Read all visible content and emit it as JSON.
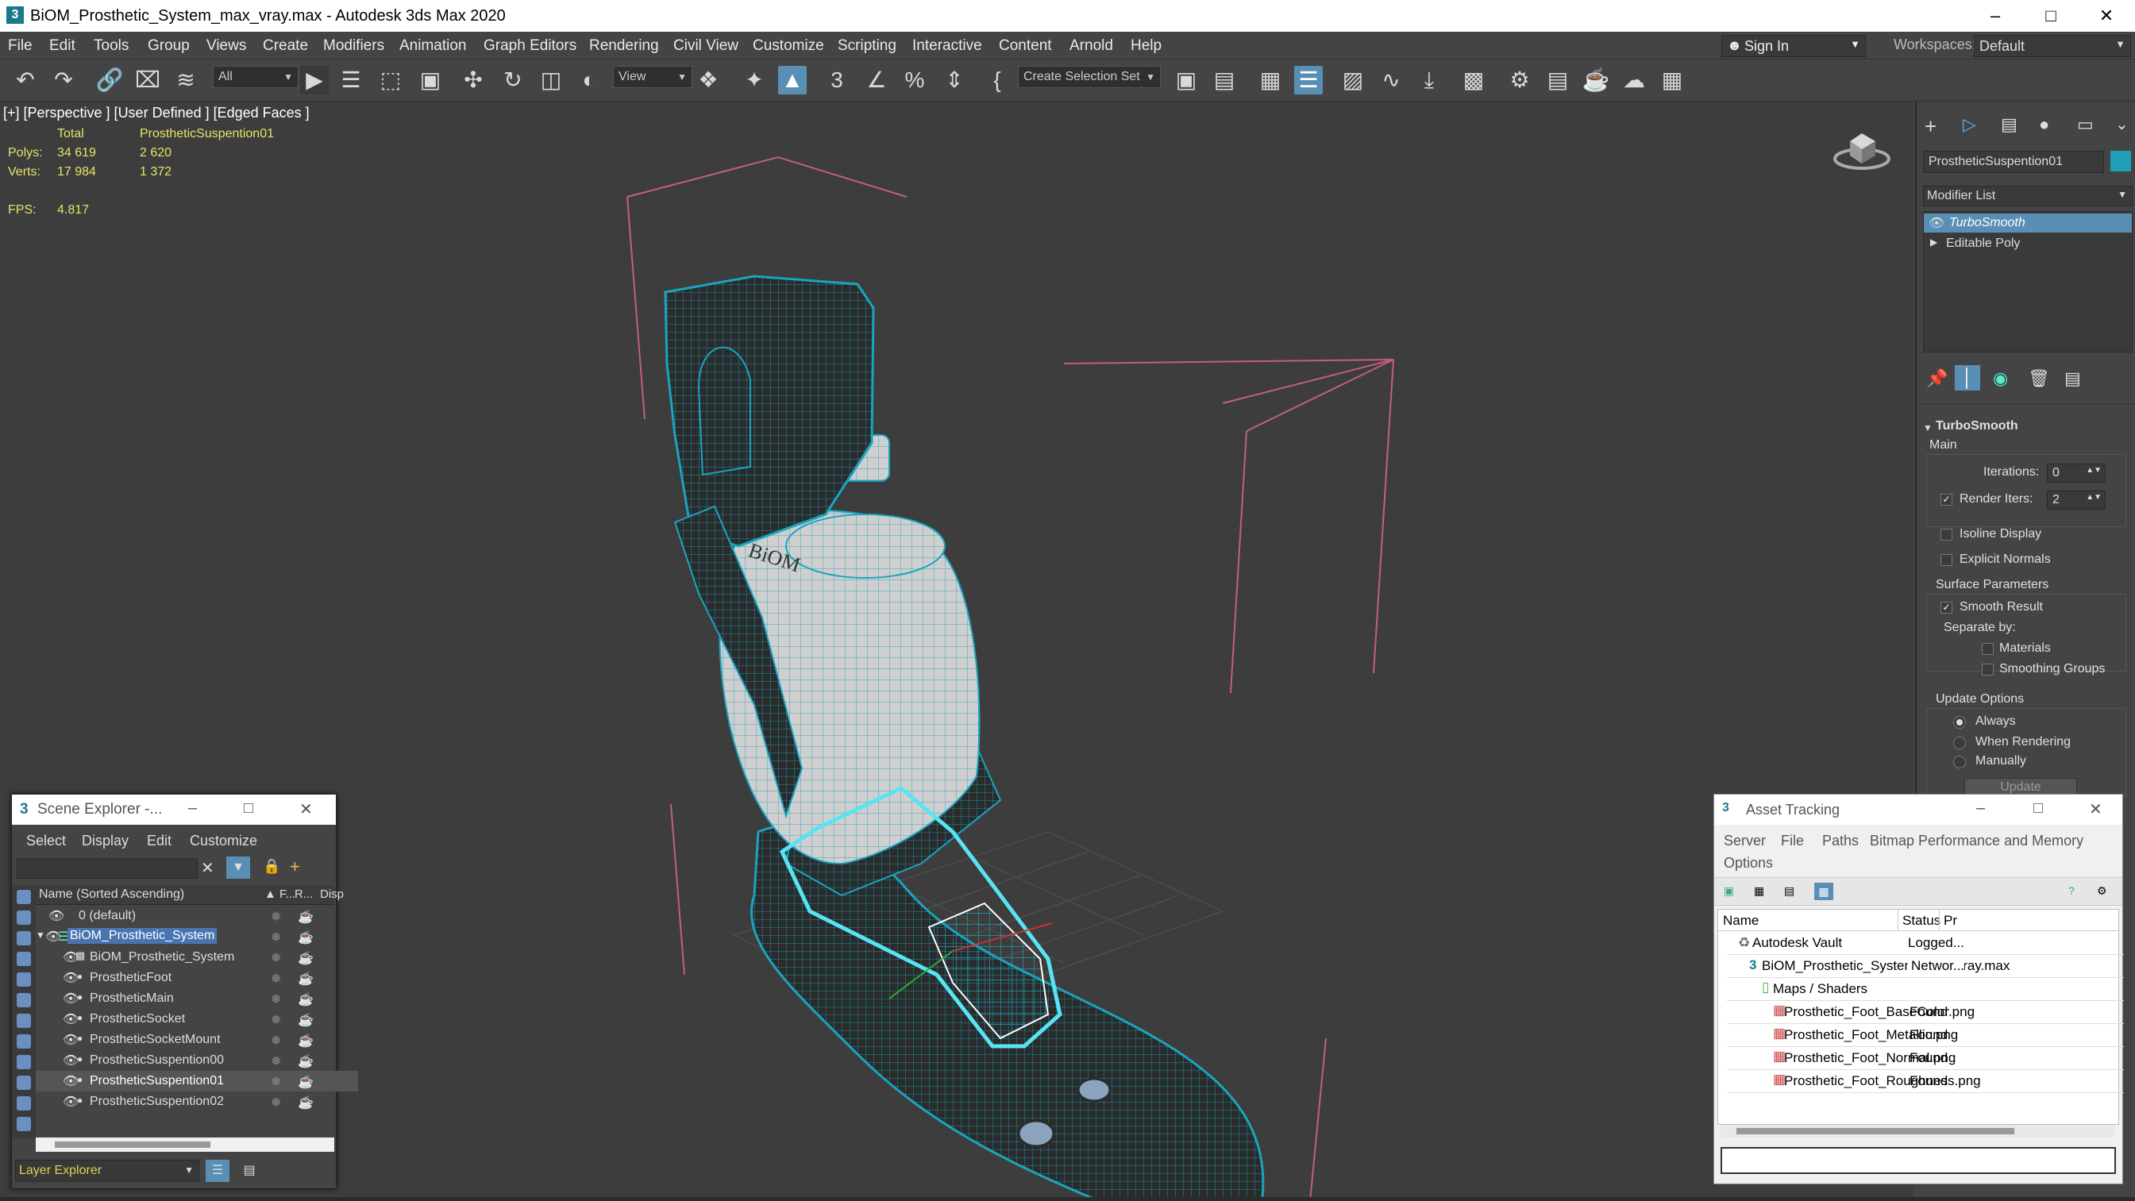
{
  "window": {
    "title": "BiOM_Prosthetic_System_max_vray.max - Autodesk 3ds Max 2020",
    "app_icon": "3ds-max-icon"
  },
  "menus": [
    "File",
    "Edit",
    "Tools",
    "Group",
    "Views",
    "Create",
    "Modifiers",
    "Animation",
    "Graph Editors",
    "Rendering",
    "Civil View",
    "Customize",
    "Scripting",
    "Interactive",
    "Content",
    "Arnold",
    "Help"
  ],
  "signin": {
    "label": "Sign In"
  },
  "workspace": {
    "label": "Workspaces:",
    "value": "Default"
  },
  "toolbar": {
    "filter_value": "All",
    "ref_coord_value": "View",
    "selection_set_value": "Create Selection Set",
    "icons": [
      "undo-icon",
      "redo-icon",
      "link-icon",
      "unlink-icon",
      "bind-space-warp-icon",
      "select-object-icon",
      "select-by-name-icon",
      "rect-region-icon",
      "window-crossing-icon",
      "move-icon",
      "rotate-icon",
      "scale-icon",
      "placement-icon",
      "pivot-icon",
      "selection-lock-icon",
      "snap-icon",
      "angle-snap-icon",
      "percent-snap-icon",
      "spinner-snap-icon",
      "edit-named-sel-icon",
      "mirror-icon",
      "align-icon",
      "scene-explorer-icon",
      "layer-explorer-icon",
      "ribbon-icon",
      "curve-editor-icon",
      "schematic-icon",
      "material-editor-icon",
      "render-setup-icon",
      "rendered-frame-icon",
      "render-icon",
      "render-cloud-icon",
      "a360-icon"
    ]
  },
  "viewport": {
    "label": "[+] [Perspective ] [User Defined ] [Edged Faces ]",
    "stats": {
      "col_total": "Total",
      "col_selected": "ProstheticSuspention01",
      "polys_label": "Polys:",
      "polys_total": "34 619",
      "polys_sel": "2 620",
      "verts_label": "Verts:",
      "verts_total": "17 984",
      "verts_sel": "1 372",
      "fps_label": "FPS:",
      "fps_value": "4.817"
    },
    "model_text": "BiOM"
  },
  "command_panel": {
    "object_name": "ProstheticSuspention01",
    "object_color": "#1fa0b8",
    "modifier_list_label": "Modifier List",
    "stack": [
      "TurboSmooth",
      "Editable Poly"
    ],
    "rollout_title": "TurboSmooth",
    "main_label": "Main",
    "iterations_label": "Iterations:",
    "iterations_value": "0",
    "render_iters_label": "Render Iters:",
    "render_iters_value": "2",
    "render_iters_checked": true,
    "isoline_label": "Isoline Display",
    "explicit_normals_label": "Explicit Normals",
    "surface_params_label": "Surface Parameters",
    "smooth_result_label": "Smooth Result",
    "separate_by_label": "Separate by:",
    "materials_label": "Materials",
    "smoothing_groups_label": "Smoothing Groups",
    "update_options_label": "Update Options",
    "always_label": "Always",
    "when_rendering_label": "When Rendering",
    "manually_label": "Manually",
    "update_button": "Update"
  },
  "scene_explorer": {
    "title": "Scene Explorer -...",
    "menus": [
      "Select",
      "Display",
      "Edit",
      "Customize"
    ],
    "col_name": "Name (Sorted Ascending)",
    "col_f": "▲ F...",
    "col_r": "R...",
    "col_disp": "Disp",
    "rows": [
      {
        "name": "0 (default)",
        "indent": 1
      },
      {
        "name": "BiOM_Prosthetic_System",
        "indent": 0
      },
      {
        "name": "BiOM_Prosthetic_System",
        "indent": 2
      },
      {
        "name": "ProstheticFoot",
        "indent": 2
      },
      {
        "name": "ProstheticMain",
        "indent": 2
      },
      {
        "name": "ProstheticSocket",
        "indent": 2
      },
      {
        "name": "ProstheticSocketMount",
        "indent": 2
      },
      {
        "name": "ProstheticSuspention00",
        "indent": 2
      },
      {
        "name": "ProstheticSuspention01",
        "indent": 2
      },
      {
        "name": "ProstheticSuspention02",
        "indent": 2
      }
    ],
    "footer_label": "Layer Explorer"
  },
  "asset_tracking": {
    "title": "Asset Tracking",
    "menus": [
      "Server",
      "File",
      "Paths",
      "Bitmap Performance and Memory",
      "Options"
    ],
    "col_name": "Name",
    "col_status": "Status",
    "col_pr": "Pr",
    "rows": [
      {
        "name": "Autodesk Vault",
        "status": "Logged...",
        "indent": 1,
        "icon": "vault-icon"
      },
      {
        "name": "BiOM_Prosthetic_System_max_vray.max",
        "status": "Networ...",
        "indent": 2,
        "icon": "max-file-icon"
      },
      {
        "name": "Maps / Shaders",
        "status": "",
        "indent": 3,
        "icon": "folder-icon"
      },
      {
        "name": "Prosthetic_Foot_BaseColor.png",
        "status": "Found",
        "indent": 4,
        "icon": "bitmap-icon"
      },
      {
        "name": "Prosthetic_Foot_Metallic.png",
        "status": "Found",
        "indent": 4,
        "icon": "bitmap-icon"
      },
      {
        "name": "Prosthetic_Foot_Normal.png",
        "status": "Found",
        "indent": 4,
        "icon": "bitmap-icon"
      },
      {
        "name": "Prosthetic_Foot_Roughness.png",
        "status": "Found",
        "indent": 4,
        "icon": "bitmap-icon"
      }
    ]
  }
}
